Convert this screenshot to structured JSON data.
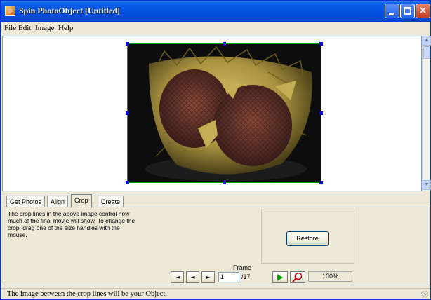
{
  "window": {
    "title": "Spin PhotoObject [Untitled]",
    "close_glyph": "×"
  },
  "menu": {
    "items": [
      "File",
      "Edit",
      "Image",
      "Help"
    ]
  },
  "tabs": [
    "Get Photos",
    "Align",
    "Crop",
    "Create"
  ],
  "active_tab": "Crop",
  "crop_panel": {
    "description": "The crop lines in the above image control how much of the final movie will show. To change the crop, drag one of the size handles with the mouse.",
    "restore_label": "Restore"
  },
  "playback": {
    "frame_label": "Frame",
    "frame_value": "1",
    "frame_total": "/17",
    "zoom": "100%",
    "first_glyph": "|◄",
    "prev_glyph": "◄",
    "next_glyph": "►"
  },
  "status": {
    "text": "The image between the crop lines will be your Object."
  },
  "colors": {
    "crop_border": "#00a000",
    "handles": "#0000ff",
    "titlebar": "#0553e3"
  }
}
